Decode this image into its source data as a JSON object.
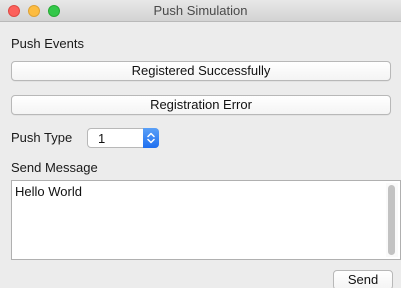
{
  "window": {
    "title": "Push Simulation"
  },
  "push_events": {
    "label": "Push Events",
    "registered_button": "Registered Successfully",
    "error_button": "Registration Error"
  },
  "push_type": {
    "label": "Push Type",
    "selected_value": "1"
  },
  "send_message": {
    "label": "Send Message",
    "text": "Hello World",
    "send_button": "Send"
  },
  "colors": {
    "close": "#fc605b",
    "minimize": "#fdbc40",
    "maximize": "#34c84a",
    "accent": "#1f6ff0"
  },
  "icons": {
    "select_arrows": "up-down-chevron-icon"
  }
}
